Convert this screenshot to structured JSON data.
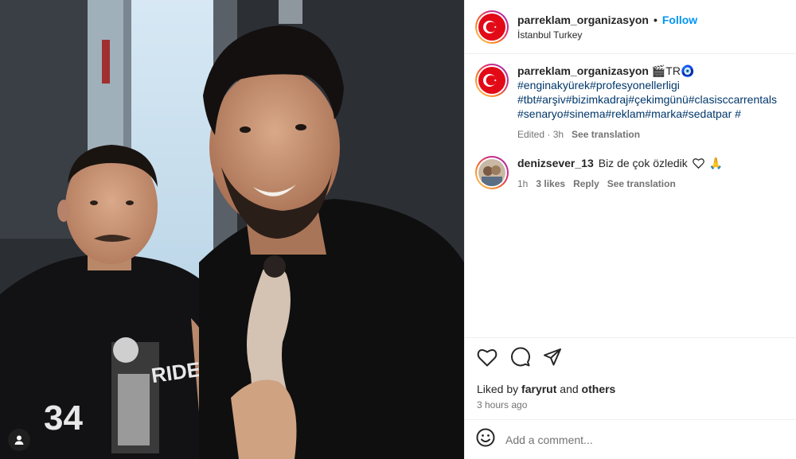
{
  "post": {
    "username": "parreklam_organizasyon",
    "follow_label": "Follow",
    "separator": "•",
    "location": "İstanbul Turkey"
  },
  "caption": {
    "username": "parreklam_organizasyon",
    "badge": "🎬TR🧿",
    "hashtags_line1": "#enginakyürek#profesyonellerligi",
    "hashtags_line2": "#tbt#arşiv#bizimkadraj#çekimgünü#clasisccarrentals",
    "hashtags_line3": "#senaryo#sinema#reklam#marka#sedatpar #",
    "edited": "Edited · 3h",
    "see_translation": "See translation"
  },
  "comment": {
    "username": "denizsever_13",
    "text": "Biz de çok özledik",
    "emoji": "🙏",
    "age": "1h",
    "likes": "3 likes",
    "reply_label": "Reply",
    "see_translation": "See translation"
  },
  "engagement": {
    "liked_by_prefix": "Liked by",
    "liked_by_user": "faryrut",
    "and_label": "and",
    "others_label": "others",
    "time_ago": "3 hours ago"
  },
  "add_comment": {
    "placeholder": "Add a comment..."
  },
  "colors": {
    "link_blue": "#0095f6",
    "hashtag": "#00376b",
    "muted": "#737373"
  },
  "photo_text": {
    "shirt_number": "34",
    "shirt_word": "RIDE"
  },
  "icons": [
    "tag-people-icon",
    "heart-icon",
    "comment-icon",
    "share-icon",
    "emoji-icon",
    "outline-heart-icon"
  ]
}
